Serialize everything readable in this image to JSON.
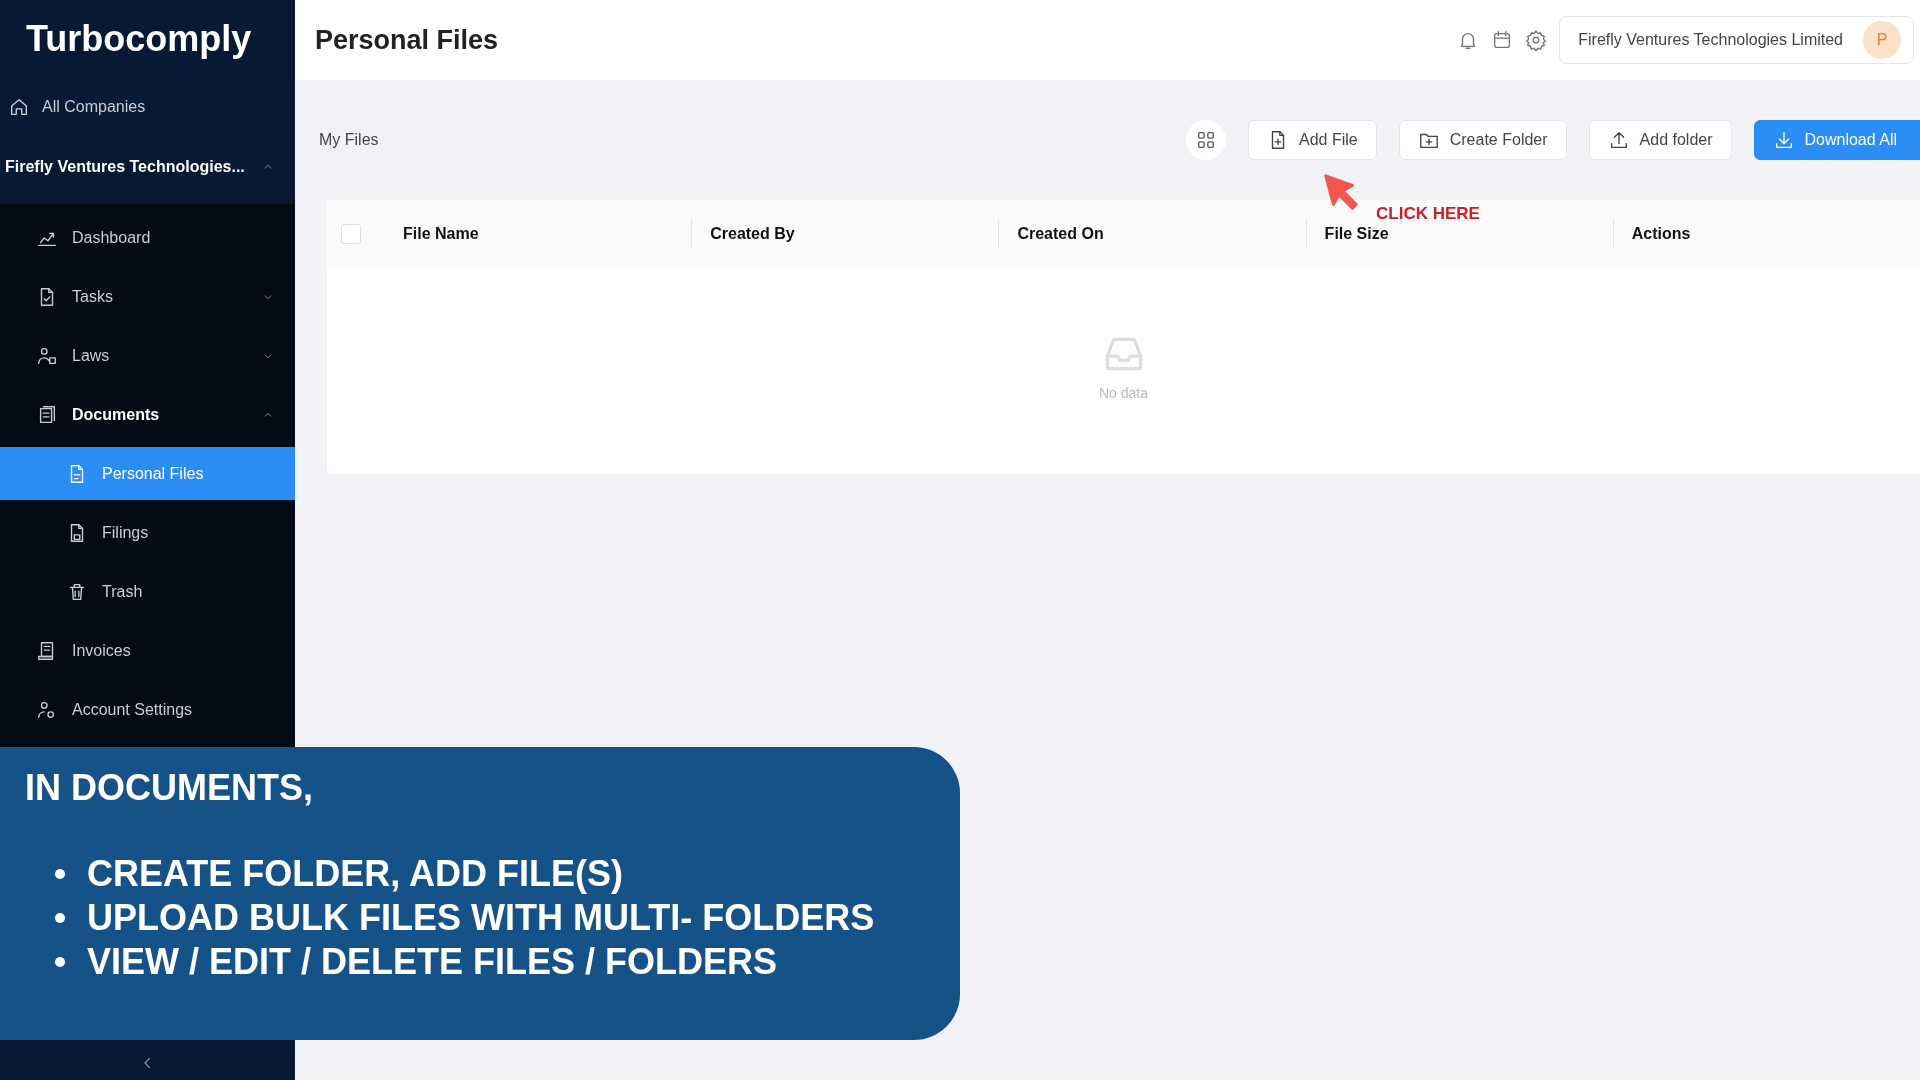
{
  "sidebar": {
    "logo": "Turbocomply",
    "all_companies": "All Companies",
    "company": {
      "label": "Firefly Ventures Technologies...",
      "expanded": true
    },
    "items": [
      {
        "label": "Dashboard",
        "selected": false
      },
      {
        "label": "Tasks",
        "selected": false,
        "expanded": false
      },
      {
        "label": "Laws",
        "selected": false,
        "expanded": false
      },
      {
        "label": "Documents",
        "selected": false,
        "expanded": true,
        "children": [
          {
            "label": "Personal Files",
            "selected": true
          },
          {
            "label": "Filings",
            "selected": false
          },
          {
            "label": "Trash",
            "selected": false
          }
        ]
      },
      {
        "label": "Invoices",
        "selected": false
      },
      {
        "label": "Account Settings",
        "selected": false
      }
    ]
  },
  "header": {
    "title": "Personal Files",
    "account": {
      "name": "Firefly Ventures Technologies Limited",
      "avatar": "P"
    }
  },
  "toolbar": {
    "label": "My Files",
    "buttons": [
      {
        "label": "Add File",
        "kind": "default"
      },
      {
        "label": "Create Folder",
        "kind": "default"
      },
      {
        "label": "Add folder",
        "kind": "default"
      },
      {
        "label": "Download All",
        "kind": "primary"
      }
    ]
  },
  "table": {
    "select_all": {
      "checked": false
    },
    "columns": [
      "File Name",
      "Created By",
      "Created On",
      "File Size",
      "Actions"
    ],
    "empty_text": "No data"
  },
  "annotation": {
    "text": "CLICK HERE"
  },
  "callout": {
    "heading": "IN DOCUMENTS,",
    "bullets": [
      "CREATE FOLDER, ADD FILE(S)",
      "UPLOAD BULK FILES WITH MULTI- FOLDERS",
      "VIEW / EDIT / DELETE FILES / FOLDERS"
    ]
  }
}
